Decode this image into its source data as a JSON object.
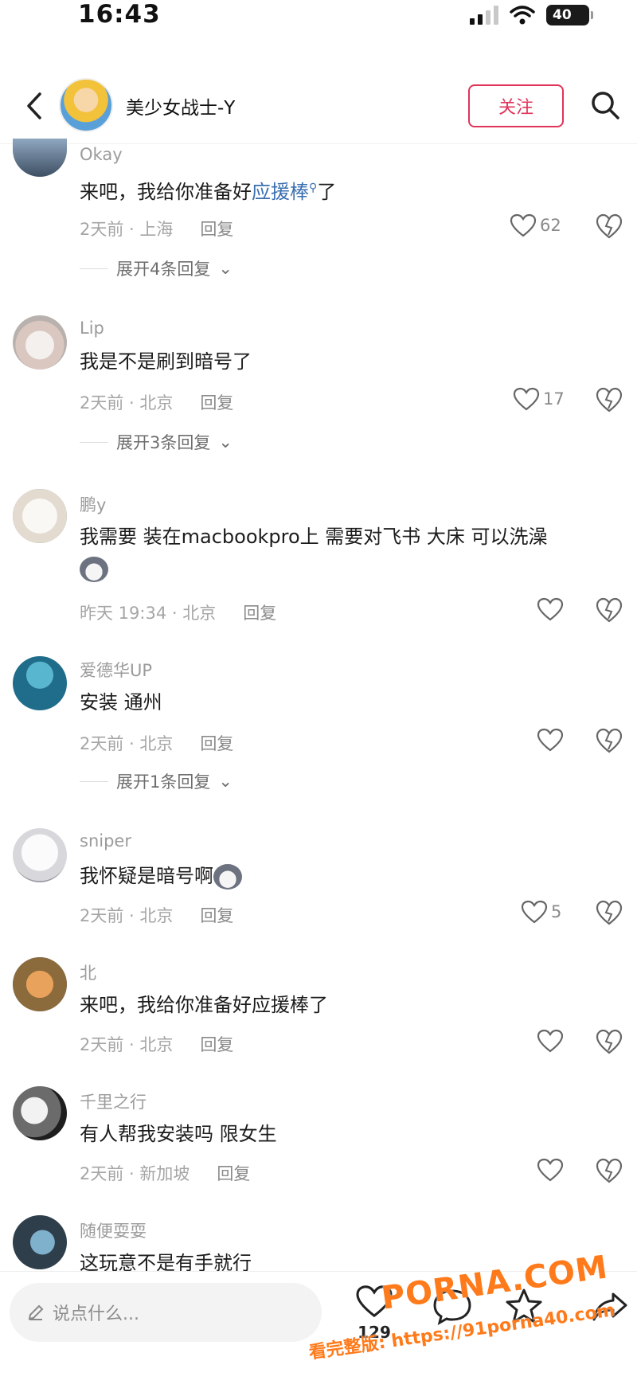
{
  "status_bar": {
    "time": "16:43",
    "battery": "40"
  },
  "header": {
    "title": "美少女战士-Y",
    "follow_label": "关注"
  },
  "comments": [
    {
      "user": "Okay",
      "text_before": "来吧，我给你准备好",
      "text_link": "应援棒",
      "text_after": "了",
      "time_location": "2天前 · 上海",
      "reply": "回复",
      "likes": "62",
      "expand": "展开4条回复"
    },
    {
      "user": "Lip",
      "text": "我是不是刷到暗号了",
      "time_location": "2天前 · 北京",
      "reply": "回复",
      "likes": "17",
      "expand": "展开3条回复"
    },
    {
      "user": "鹏y",
      "text": "我需要 装在macbookpro上 需要对飞书 大床 可以洗澡",
      "time_location": "昨天 19:34 · 北京",
      "reply": "回复",
      "likes": ""
    },
    {
      "user": "爱德华UP",
      "text": "安装 通州",
      "time_location": "2天前 · 北京",
      "reply": "回复",
      "likes": "",
      "expand": "展开1条回复"
    },
    {
      "user": "sniper",
      "text": "我怀疑是暗号啊",
      "time_location": "2天前 · 北京",
      "reply": "回复",
      "likes": "5"
    },
    {
      "user": "北",
      "text": "来吧，我给你准备好应援棒了",
      "time_location": "2天前 · 北京",
      "reply": "回复",
      "likes": ""
    },
    {
      "user": "千里之行",
      "text": "有人帮我安装吗 限女生",
      "time_location": "2天前 · 新加坡",
      "reply": "回复",
      "likes": ""
    },
    {
      "user": "随便耍耍",
      "text": "这玩意不是有手就行"
    }
  ],
  "bottom_bar": {
    "input_placeholder": "说点什么...",
    "like_count": "129"
  },
  "watermark": {
    "logo": "PORNA.COM",
    "url": "看完整版: https://91porna40.com"
  },
  "colors": {
    "accent": "#e0345a",
    "link": "#3a6fb0",
    "watermark": "#ff7a1a"
  }
}
